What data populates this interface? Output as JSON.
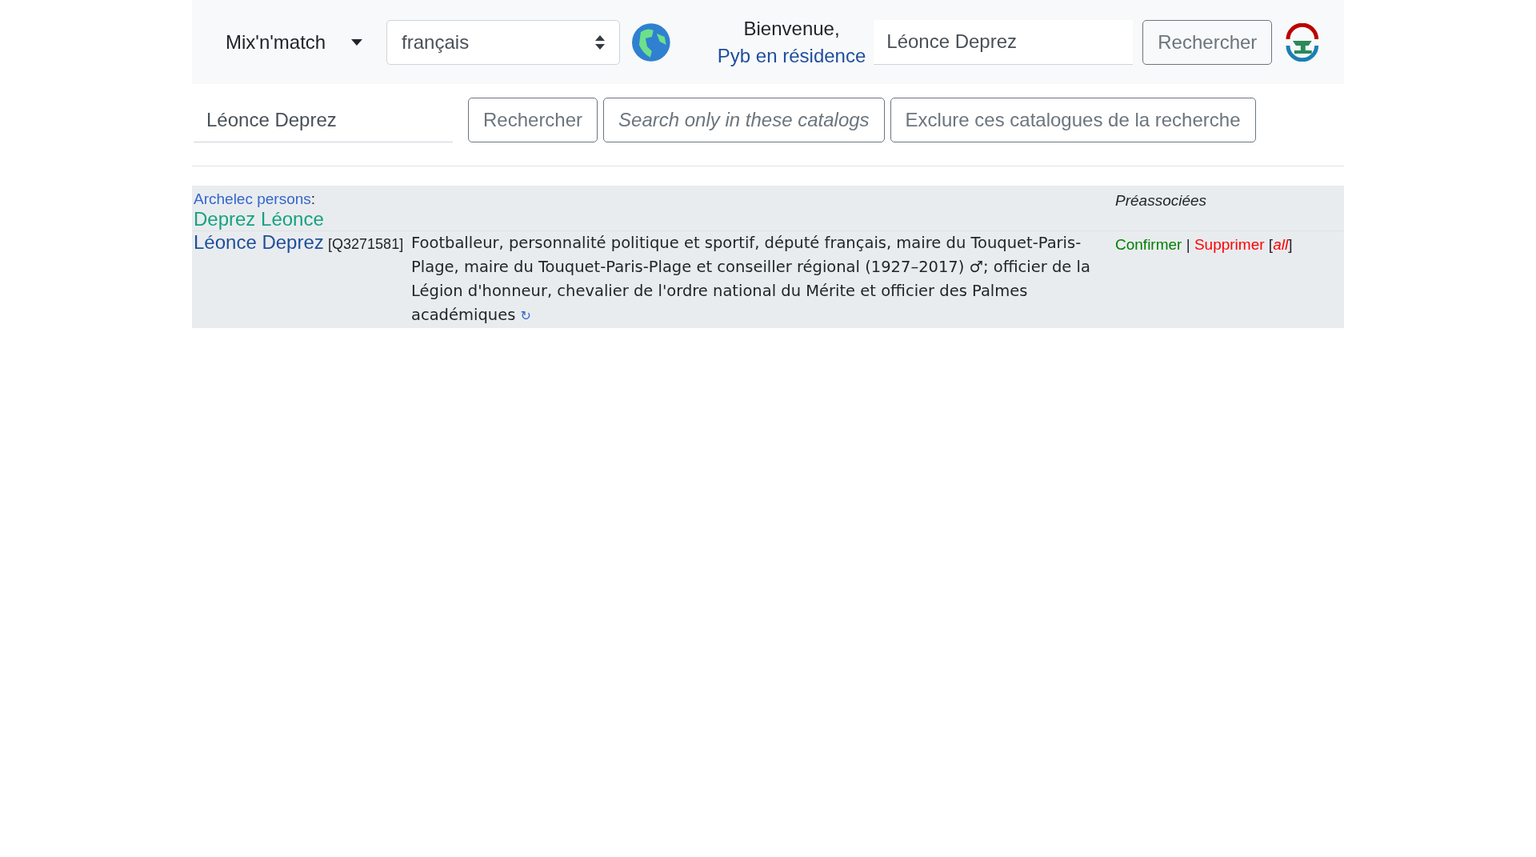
{
  "navbar": {
    "brand": "Mix'n'match",
    "language_select": {
      "value": "français"
    },
    "welcome": "Bienvenue,",
    "user": "Pyb en résidence",
    "search": {
      "value": "Léonce Deprez"
    },
    "search_button": "Rechercher"
  },
  "search_bar": {
    "query": {
      "value": "Léonce Deprez"
    },
    "buttons": [
      {
        "label": "Rechercher",
        "kind": "plain"
      },
      {
        "label": "Search only in these catalogs",
        "kind": "italic"
      },
      {
        "label": "Exclure ces catalogues de la recherche",
        "kind": "plain"
      }
    ]
  },
  "results": [
    {
      "catalog": "Archelec persons",
      "separator": ":",
      "entry_name": "Deprez Léonce",
      "status": "Préassociées",
      "match_name": "Léonce Deprez",
      "qid": "[Q3271581]",
      "description": "Footballeur, personnalité politique et sportif, député français, maire du Touquet-Paris-Plage, maire du Touquet-Paris-Plage et conseiller régional (1927–2017) ♂; officier de la Légion d'honneur, chevalier de l'ordre national du Mérite et officier des Palmes académiques",
      "refresh": "↻",
      "actions": {
        "confirm": "Confirmer",
        "divider": "|",
        "remove": "Supprimer",
        "all_open": "[",
        "all": "all",
        "all_close": "]"
      }
    }
  ]
}
